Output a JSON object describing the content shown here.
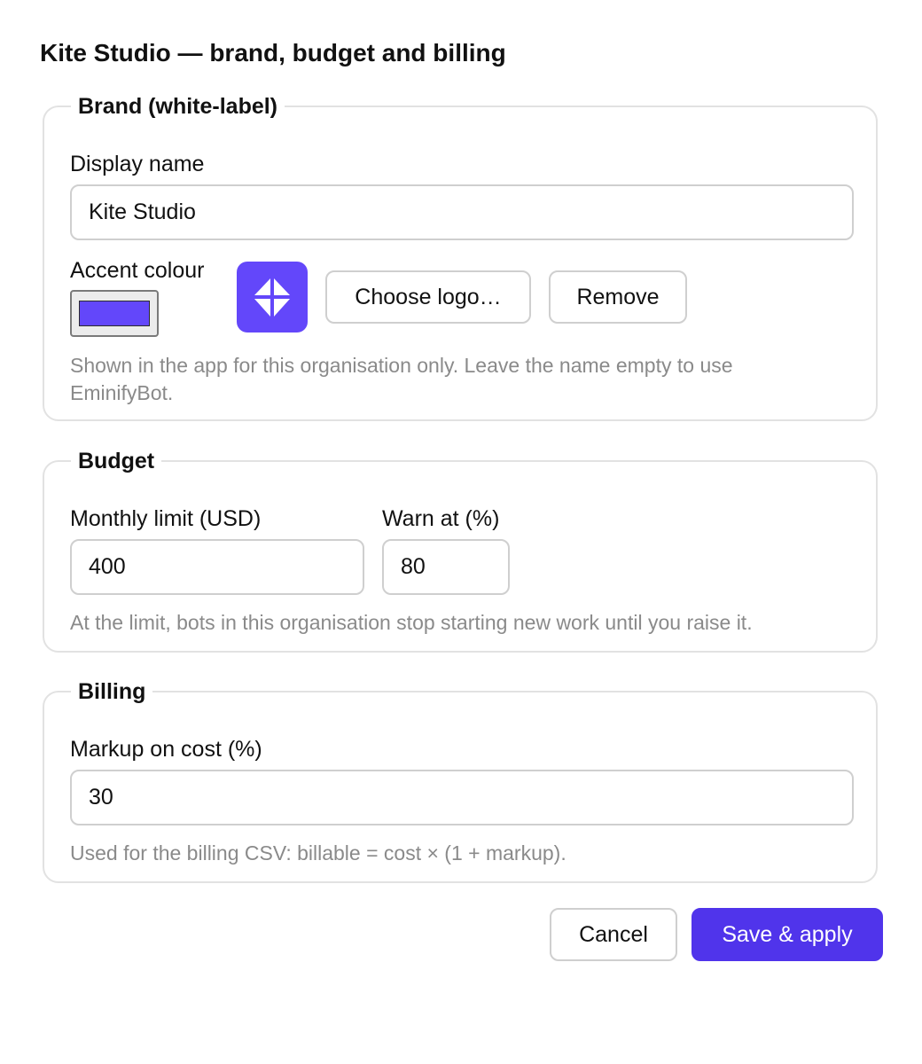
{
  "dialog": {
    "title": "Kite Studio — brand, budget and billing"
  },
  "brand": {
    "legend": "Brand (white-label)",
    "display_name_label": "Display name",
    "display_name_value": "Kite Studio",
    "accent_label": "Accent colour",
    "accent_color": "#6347fa",
    "logo_color": "#6347fa",
    "logo_icon": "kite-logo-icon",
    "choose_logo_label": "Choose logo…",
    "remove_label": "Remove",
    "hint": "Shown in the app for this organisation only. Leave the name empty to use EminifyBot."
  },
  "budget": {
    "legend": "Budget",
    "monthly_limit_label": "Monthly limit (USD)",
    "monthly_limit_value": "400",
    "warn_label": "Warn at (%)",
    "warn_value": "80",
    "hint": "At the limit, bots in this organisation stop starting new work until you raise it."
  },
  "billing": {
    "legend": "Billing",
    "markup_label": "Markup on cost (%)",
    "markup_value": "30",
    "hint": "Used for the billing CSV: billable = cost × (1 + markup)."
  },
  "actions": {
    "cancel_label": "Cancel",
    "save_label": "Save & apply",
    "primary_color": "#5034eb"
  }
}
